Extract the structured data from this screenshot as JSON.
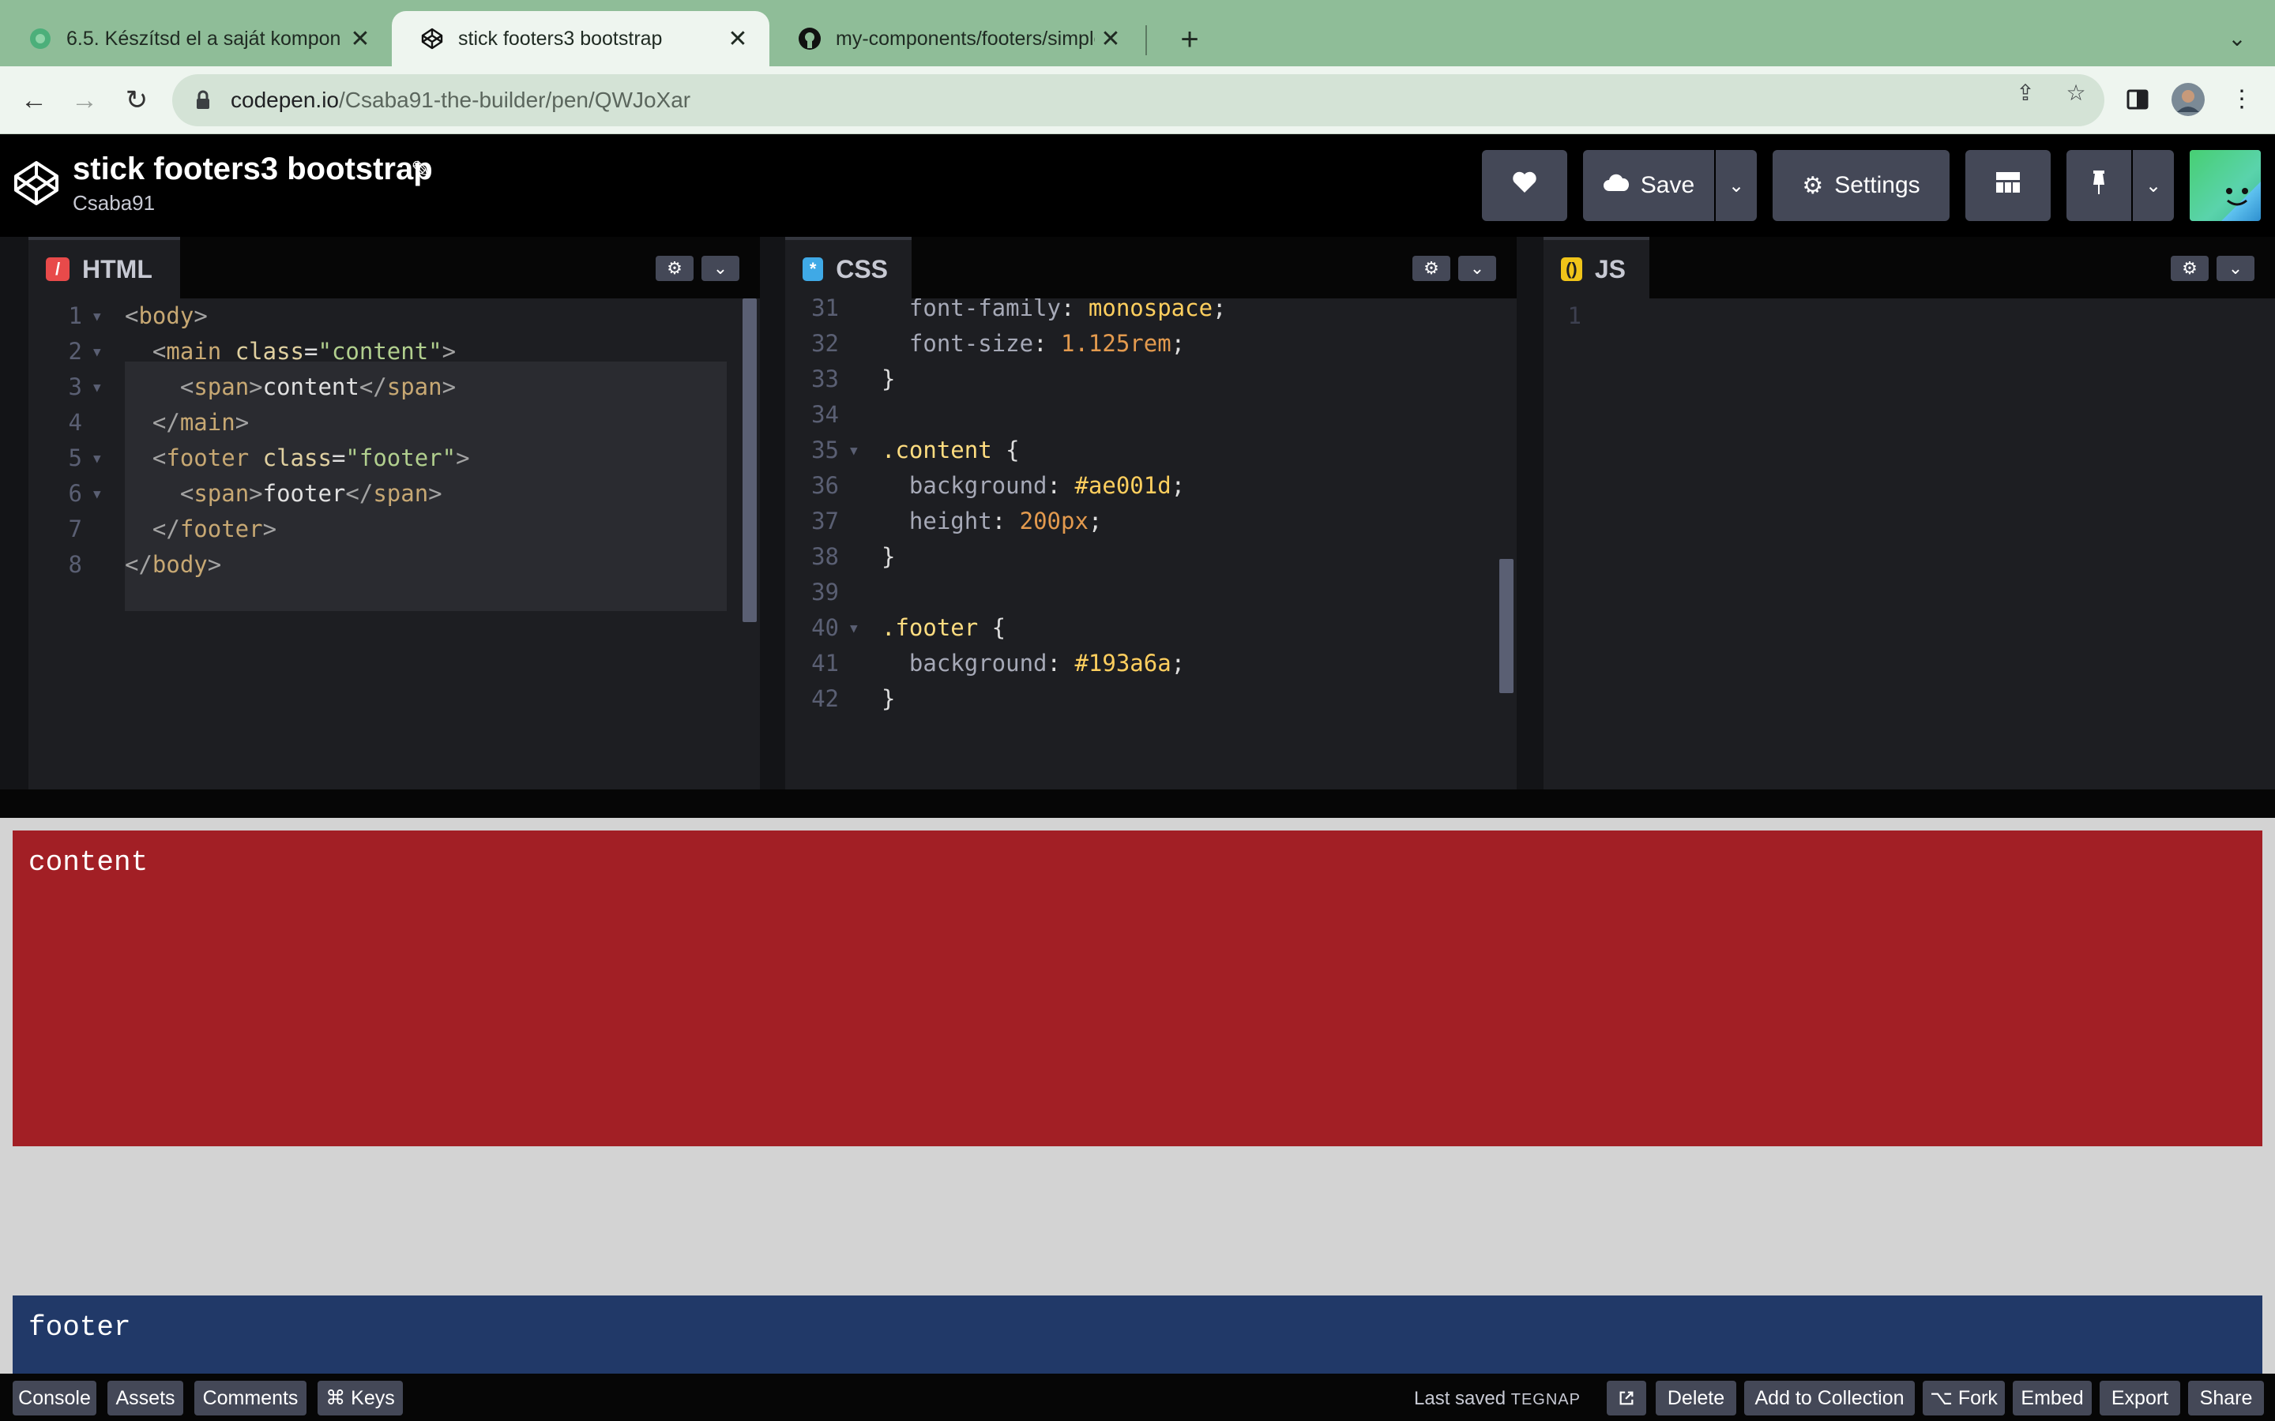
{
  "browser": {
    "tabs": [
      {
        "title": "6.5. Készítsd el a saját kompon",
        "active": false,
        "favicon": "circle-green-icon"
      },
      {
        "title": "stick footers3 bootstrap",
        "active": true,
        "favicon": "codepen-icon"
      },
      {
        "title": "my-components/footers/simple",
        "active": false,
        "favicon": "github-icon"
      }
    ],
    "address": {
      "domain": "codepen.io",
      "path": "/Csaba91-the-builder/pen/QWJoXar"
    }
  },
  "pen": {
    "title": "stick footers3 bootstrap",
    "author": "Csaba91",
    "buttons": {
      "save": "Save",
      "settings": "Settings"
    }
  },
  "editors": {
    "html": {
      "name": "HTML",
      "lines": [
        {
          "n": "1",
          "fold": true
        },
        {
          "n": "2",
          "fold": true
        },
        {
          "n": "3",
          "fold": true
        },
        {
          "n": "4",
          "fold": false
        },
        {
          "n": "5",
          "fold": true
        },
        {
          "n": "6",
          "fold": true
        },
        {
          "n": "7",
          "fold": false
        },
        {
          "n": "8",
          "fold": false
        }
      ],
      "code": {
        "l1_tag": "body",
        "l2_tag": "main",
        "l2_attr": "class",
        "l2_val": "\"content\"",
        "l3_tag": "span",
        "l3_text": "content",
        "l4_tag": "main",
        "l5_tag": "footer",
        "l5_attr": "class",
        "l5_val": "\"footer\"",
        "l6_tag": "span",
        "l6_text": "footer",
        "l7_tag": "footer",
        "l8_tag": "body"
      }
    },
    "css": {
      "name": "CSS",
      "lines": [
        "31",
        "32",
        "33",
        "34",
        "35",
        "36",
        "37",
        "38",
        "39",
        "40",
        "41",
        "42"
      ],
      "code": {
        "l31_prop": "font-family",
        "l31_val": "monospace",
        "l32_prop": "font-size",
        "l32_val": "1.125rem",
        "l35_sel": ".content",
        "l36_prop": "background",
        "l36_val": "#ae001d",
        "l37_prop": "height",
        "l37_val": "200px",
        "l40_sel": ".footer",
        "l41_prop": "background",
        "l41_val": "#193a6a"
      }
    },
    "js": {
      "name": "JS",
      "lines": [
        "1"
      ]
    }
  },
  "preview": {
    "content_text": "content",
    "footer_text": "footer"
  },
  "bottom": {
    "console": "Console",
    "assets": "Assets",
    "comments": "Comments",
    "keys": "⌘ Keys",
    "last_saved": "Last saved",
    "last_saved_ago": "TEGNAP",
    "delete": "Delete",
    "add_to_collection": "Add to Collection",
    "fork": "⌥ Fork",
    "embed": "Embed",
    "export": "Export",
    "share": "Share"
  },
  "colors": {
    "accent": "#47cf73",
    "content_bg": "#a21f25",
    "footer_bg": "#213968"
  }
}
